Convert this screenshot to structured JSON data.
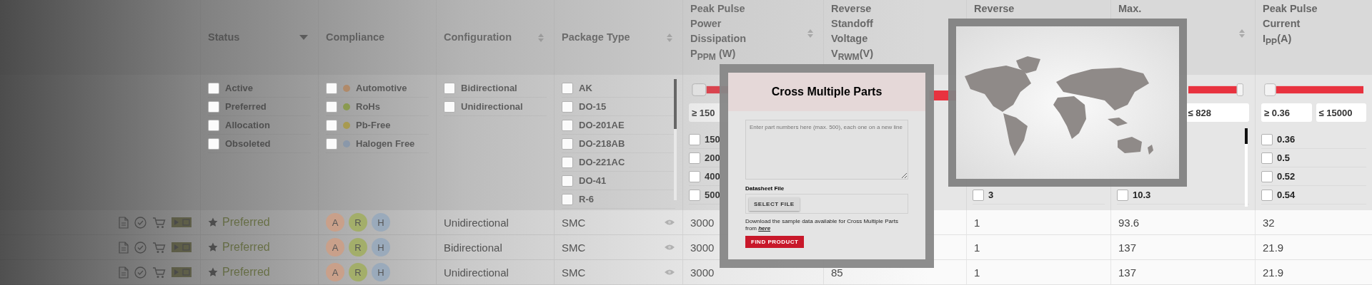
{
  "columns": [
    {
      "header": [
        "Status"
      ],
      "menu_icon": true,
      "filter": {
        "kind": "checklist",
        "options": [
          {
            "label": "Active",
            "checked": false
          },
          {
            "label": "Preferred",
            "checked": false
          },
          {
            "label": "Allocation",
            "checked": false
          },
          {
            "label": "Obsoleted",
            "checked": false
          }
        ]
      }
    },
    {
      "header": [
        "Compliance"
      ],
      "filter": {
        "kind": "checklist",
        "options": [
          {
            "label": "Automotive",
            "checked": false,
            "color": "#b08a6a"
          },
          {
            "label": "RoHs",
            "checked": false,
            "color": "#8a9a50"
          },
          {
            "label": "Pb-Free",
            "checked": false,
            "color": "#a89a50"
          },
          {
            "label": "Halogen Free",
            "checked": false,
            "color": "#8a98aa"
          }
        ]
      }
    },
    {
      "header": [
        "Configuration"
      ],
      "sort_icon": true,
      "filter": {
        "kind": "checklist",
        "options": [
          {
            "label": "Bidirectional",
            "checked": false
          },
          {
            "label": "Unidirectional",
            "checked": false
          }
        ]
      }
    },
    {
      "header": [
        "Package Type"
      ],
      "sort_icon": true,
      "filter": {
        "kind": "checklist",
        "scroll": true,
        "options": [
          {
            "label": "AK",
            "checked": false
          },
          {
            "label": "DO-15",
            "checked": false
          },
          {
            "label": "DO-201AE",
            "checked": false
          },
          {
            "label": "DO-218AB",
            "checked": false
          },
          {
            "label": "DO-221AC",
            "checked": false
          },
          {
            "label": "DO-41",
            "checked": false
          },
          {
            "label": "R-6",
            "checked": false
          }
        ]
      }
    },
    {
      "header": [
        "Peak Pulse",
        "Power",
        "Dissipation",
        "P$_{PPM}$ (W)"
      ],
      "sort_icon": true,
      "filter": {
        "kind": "range",
        "handle_upper": false,
        "inputs": [
          {
            "upper": false,
            "value": "≥ 150"
          }
        ],
        "options": [
          {
            "label": "150",
            "checked": false
          },
          {
            "label": "200",
            "checked": false
          },
          {
            "label": "400",
            "checked": false
          },
          {
            "label": "500",
            "checked": false
          }
        ]
      }
    },
    {
      "header": [
        "Reverse",
        "Standoff",
        "Voltage",
        "V$_{RWM}$(V)"
      ],
      "filter": {
        "kind": "track"
      }
    },
    {
      "header": [
        "Reverse"
      ],
      "filter": {
        "kind": "range",
        "options": [
          {
            "label": "3",
            "checked": false
          }
        ]
      }
    },
    {
      "header": [
        "Max."
      ],
      "sort_icon": true,
      "filter": {
        "kind": "range",
        "handle_upper": true,
        "scroll": true,
        "inputs": [
          {
            "upper": true,
            "value": "≤ 828"
          }
        ],
        "options": [
          {
            "label": "10.3",
            "checked": false
          }
        ]
      }
    },
    {
      "header": [
        "Peak Pulse",
        "Current",
        "I$_{PP}$(A)"
      ],
      "filter": {
        "kind": "range",
        "handle_upper": false,
        "inputs": [
          {
            "upper": false,
            "value": "≥ 0.36"
          },
          {
            "upper": true,
            "value": "≤ 15000"
          }
        ],
        "options": [
          {
            "label": "0.36",
            "checked": false
          },
          {
            "label": "0.5",
            "checked": false
          },
          {
            "label": "0.52",
            "checked": false
          },
          {
            "label": "0.54",
            "checked": false
          }
        ]
      }
    }
  ],
  "rows": [
    {
      "status": "Preferred",
      "badges": [
        {
          "label": "A",
          "color": "#c9a08a"
        },
        {
          "label": "R",
          "color": "#a3ae6a"
        },
        {
          "label": "H",
          "color": "#9aaabb"
        }
      ],
      "configuration": "Unidirectional",
      "package": "SMC",
      "power": "3000",
      "reverse": "1",
      "clamping": "93.6",
      "current": "32"
    },
    {
      "status": "Preferred",
      "badges": [
        {
          "label": "A",
          "color": "#c9a08a"
        },
        {
          "label": "R",
          "color": "#a3ae6a"
        },
        {
          "label": "H",
          "color": "#9aaabb"
        }
      ],
      "configuration": "Bidirectional",
      "package": "SMC",
      "power": "3000",
      "reverse": "1",
      "clamping": "137",
      "current": "21.9"
    },
    {
      "status": "Preferred",
      "badges": [
        {
          "label": "A",
          "color": "#c9a08a"
        },
        {
          "label": "R",
          "color": "#a3ae6a"
        },
        {
          "label": "H",
          "color": "#9aaabb"
        }
      ],
      "configuration": "Unidirectional",
      "package": "SMC",
      "power": "3000",
      "standoff": "85",
      "reverse": "1",
      "clamping": "137",
      "current": "21.9"
    }
  ],
  "modal": {
    "title": "Cross Multiple Parts",
    "placeholder": "Enter part numbers here (max. 500), each one on a new line",
    "file_label": "Datasheet File",
    "file_button": "SELECT FILE",
    "note": "Download the sample data available for Cross Multiple Parts from",
    "note_link": "here",
    "submit": "FIND PRODUCT"
  }
}
